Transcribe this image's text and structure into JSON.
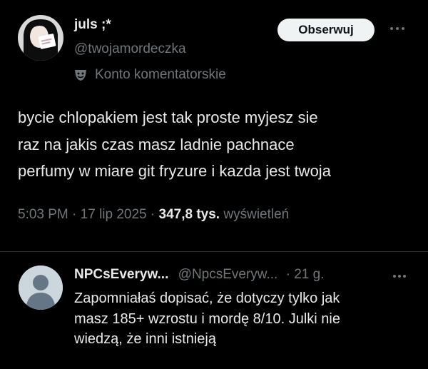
{
  "tweet": {
    "author": {
      "display_name": "juls ;*",
      "handle": "@twojamordeczka"
    },
    "follow_label": "Obserwuj",
    "more_icon": "more-horizontal-icon",
    "badge": {
      "icon": "masks-icon",
      "label": "Konto komentatorskie"
    },
    "text_lines": [
      "bycie chlopakiem jest tak proste myjesz sie",
      "raz na jakis czas masz ladnie pachnace",
      "perfumy w miare git fryzure i kazda jest twoja"
    ],
    "meta": {
      "time": "5:03 PM",
      "separator": "·",
      "date": "17 lip 2025",
      "views_count": "347,8 tys.",
      "views_label": "wyświetleń"
    }
  },
  "reply": {
    "author": {
      "display_name": "NPCsEveryw...",
      "handle": "@NpcsEveryw..."
    },
    "time": "· 21 g.",
    "more_icon": "more-horizontal-icon",
    "avatar_icon": "default-avatar-icon",
    "text_lines": [
      "Zapomniałaś dopisać, że dotyczy tylko jak",
      "masz 185+ wzrostu i mordę 8/10. Julki nie",
      "wiedzą, że inni istnieją"
    ]
  },
  "colors": {
    "background": "#000000",
    "text_primary": "#e7e9ea",
    "text_secondary": "#71767b",
    "divider": "#2f3336",
    "follow_button_bg": "#eff3f4"
  }
}
